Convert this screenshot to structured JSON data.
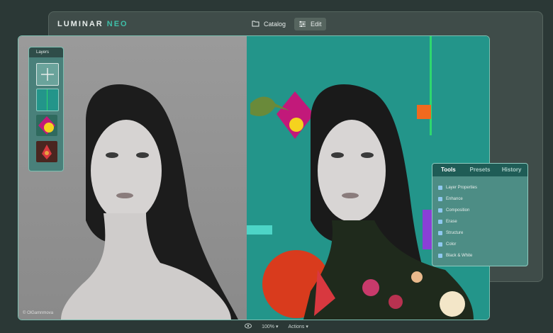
{
  "app": {
    "logo_main": "LUMINAR",
    "logo_accent": "NEO"
  },
  "top_nav": {
    "catalog_label": "Catalog",
    "edit_label": "Edit"
  },
  "layers_panel": {
    "title": "Layers"
  },
  "tools_panel": {
    "tabs": [
      "Tools",
      "Presets",
      "History"
    ],
    "items": [
      "Layer Properties",
      "Enhance",
      "Composition",
      "Erase",
      "Structure",
      "Color",
      "Black & White"
    ]
  },
  "photo": {
    "watermark": "© OlGamnmova"
  },
  "bottom_bar": {
    "zoom": "100% ▾",
    "actions": "Actions ▾"
  },
  "colors": {
    "background": "#2b3836",
    "accent": "#3fbfa8",
    "teal_canvas": "#23958a"
  }
}
